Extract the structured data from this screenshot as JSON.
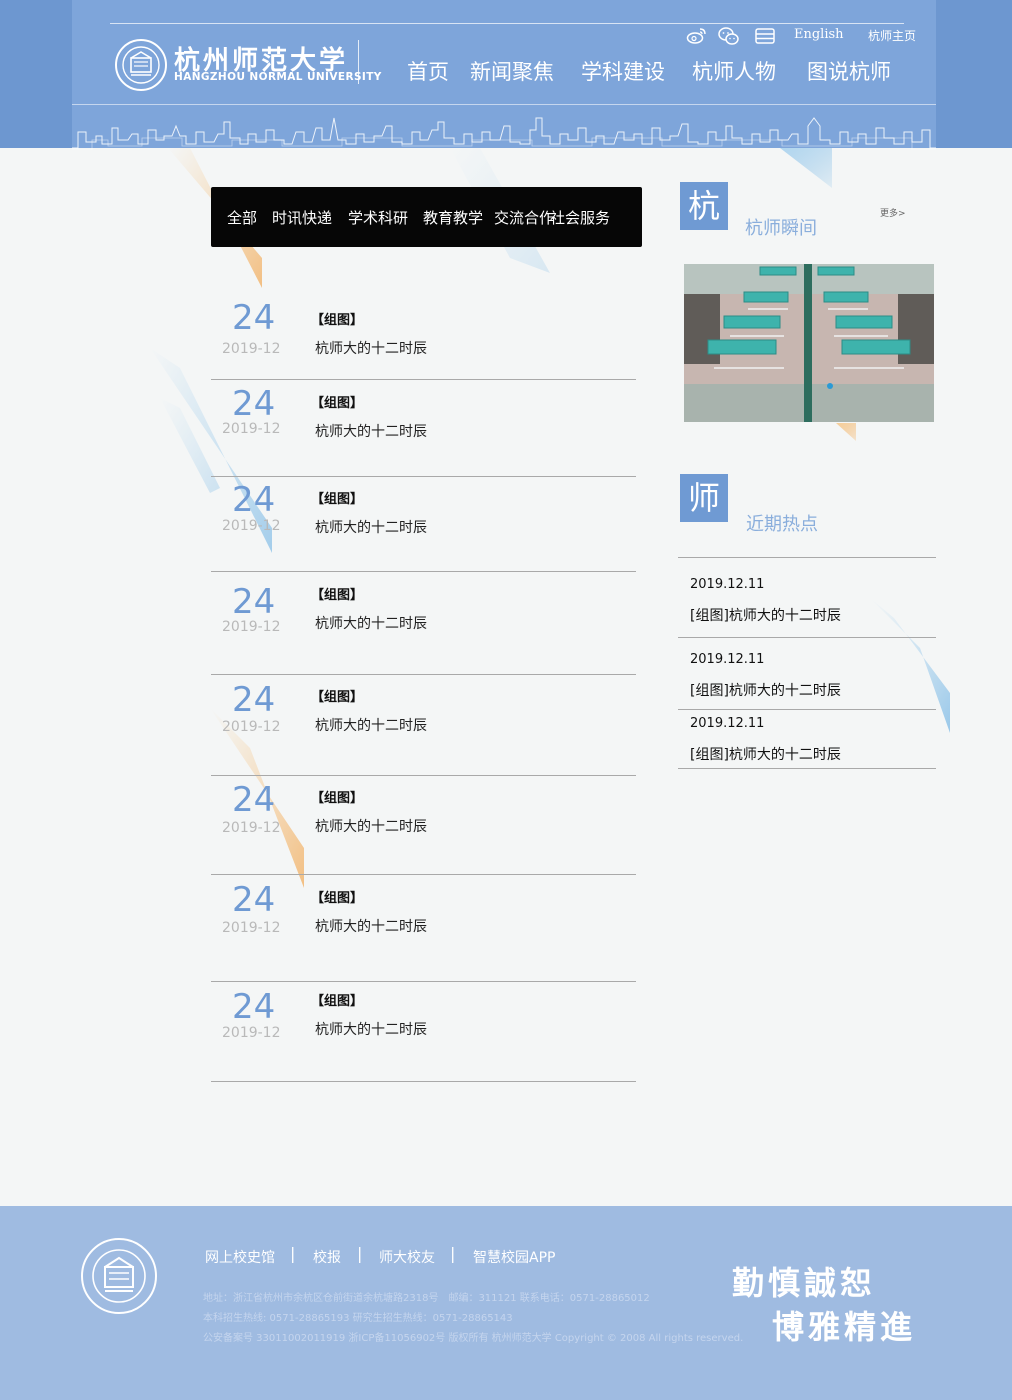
{
  "header": {
    "logo_cn": "杭州师范大学",
    "logo_en": "HANGZHOU NORMAL UNIVERSITY",
    "top_icons": [
      "weibo-icon",
      "wechat-icon",
      "list-icon"
    ],
    "english_link": "English",
    "home_link": "杭师主页",
    "nav": [
      "首页",
      "新闻聚焦",
      "学科建设",
      "杭师人物",
      "图说杭师"
    ]
  },
  "categories": [
    "全部",
    "时讯快递",
    "学术科研",
    "教育教学",
    "交流合作",
    "社会服务"
  ],
  "news": [
    {
      "day": "24",
      "ym": "2019-12",
      "tag": "【组图】",
      "title": "杭师大的十二时辰"
    },
    {
      "day": "24",
      "ym": "2019-12",
      "tag": "【组图】",
      "title": "杭师大的十二时辰"
    },
    {
      "day": "24",
      "ym": "2019-12",
      "tag": "【组图】",
      "title": "杭师大的十二时辰"
    },
    {
      "day": "24",
      "ym": "2019-12",
      "tag": "【组图】",
      "title": "杭师大的十二时辰"
    },
    {
      "day": "24",
      "ym": "2019-12",
      "tag": "【组图】",
      "title": "杭师大的十二时辰"
    },
    {
      "day": "24",
      "ym": "2019-12",
      "tag": "【组图】",
      "title": "杭师大的十二时辰"
    },
    {
      "day": "24",
      "ym": "2019-12",
      "tag": "【组图】",
      "title": "杭师大的十二时辰"
    },
    {
      "day": "24",
      "ym": "2019-12",
      "tag": "【组图】",
      "title": "杭师大的十二时辰"
    }
  ],
  "sidebar": {
    "moments_badge": "杭",
    "moments_title": "杭师瞬间",
    "more": "更多>",
    "hot_badge": "师",
    "hot_title": "近期热点",
    "hot": [
      {
        "date": "2019.12.11",
        "title": "[组图]杭师大的十二时辰"
      },
      {
        "date": "2019.12.11",
        "title": "[组图]杭师大的十二时辰"
      },
      {
        "date": "2019.12.11",
        "title": "[组图]杭师大的十二时辰"
      }
    ]
  },
  "footer": {
    "links": [
      "网上校史馆",
      "校报",
      "师大校友",
      "智慧校园APP"
    ],
    "separator": "|",
    "info": [
      "地址：浙江省杭州市余杭区仓前街道余杭塘路2318号　邮编：311121 联系电话：0571-28865012",
      "本科招生热线: 0571-28865193 研究生招生热线：0571-28865143",
      "公安备案号 33011002011919 浙ICP备11056902号 版权所有 杭州师范大学 Copyright © 2008 All rights reserved."
    ],
    "motto_line1": "勤慎誠恕",
    "motto_line2": "博雅精進"
  },
  "colors": {
    "header_bg": "#6d97d0",
    "accent_blue": "#6f9ad3",
    "category_bar": "#060606",
    "footer_bg": "#9fbbe1"
  }
}
